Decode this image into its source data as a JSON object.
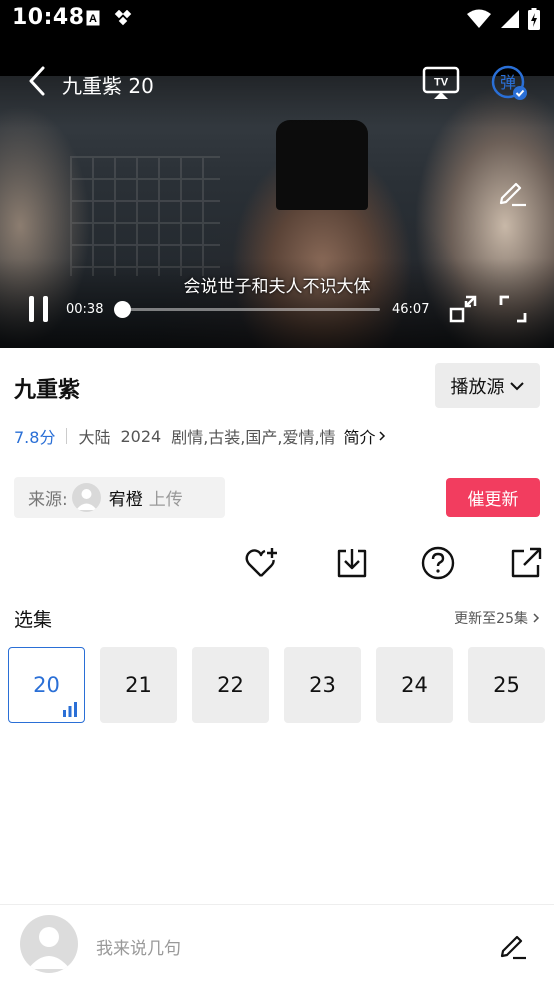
{
  "status_bar": {
    "time": "10:48",
    "left_icons": [
      "font-a-icon",
      "diamond-dots-icon"
    ],
    "right_icons": [
      "wifi-icon",
      "signal-icon",
      "battery-charging-icon"
    ]
  },
  "player": {
    "title": "九重紫 20",
    "subtitle": "会说世子和夫人不识大体",
    "current_time": "00:38",
    "total_time": "46:07",
    "progress": 0.014,
    "danmu_label": "弹",
    "tv_label": "TV"
  },
  "show": {
    "title": "九重紫",
    "source_button": "播放源",
    "rating": "7.8分",
    "region": "大陆",
    "year": "2024",
    "genres": "剧情,古装,国产,爱情,情",
    "intro_link": "简介"
  },
  "source": {
    "label": "来源:",
    "uploader": "宥橙",
    "upload_text": "上传"
  },
  "urge_button": "催更新",
  "actions": [
    "favorite-add-icon",
    "download-icon",
    "help-icon",
    "share-icon"
  ],
  "episodes": {
    "heading": "选集",
    "updated_text": "更新至25集",
    "items": [
      {
        "label": "20",
        "active": true
      },
      {
        "label": "21",
        "active": false
      },
      {
        "label": "22",
        "active": false
      },
      {
        "label": "23",
        "active": false
      },
      {
        "label": "24",
        "active": false
      },
      {
        "label": "25",
        "active": false
      }
    ]
  },
  "comment_bar": {
    "placeholder": "我来说几句"
  },
  "colors": {
    "accent_blue": "#2a6fd6",
    "urge_red": "#f23d5f",
    "chip_gray": "#ececec"
  }
}
